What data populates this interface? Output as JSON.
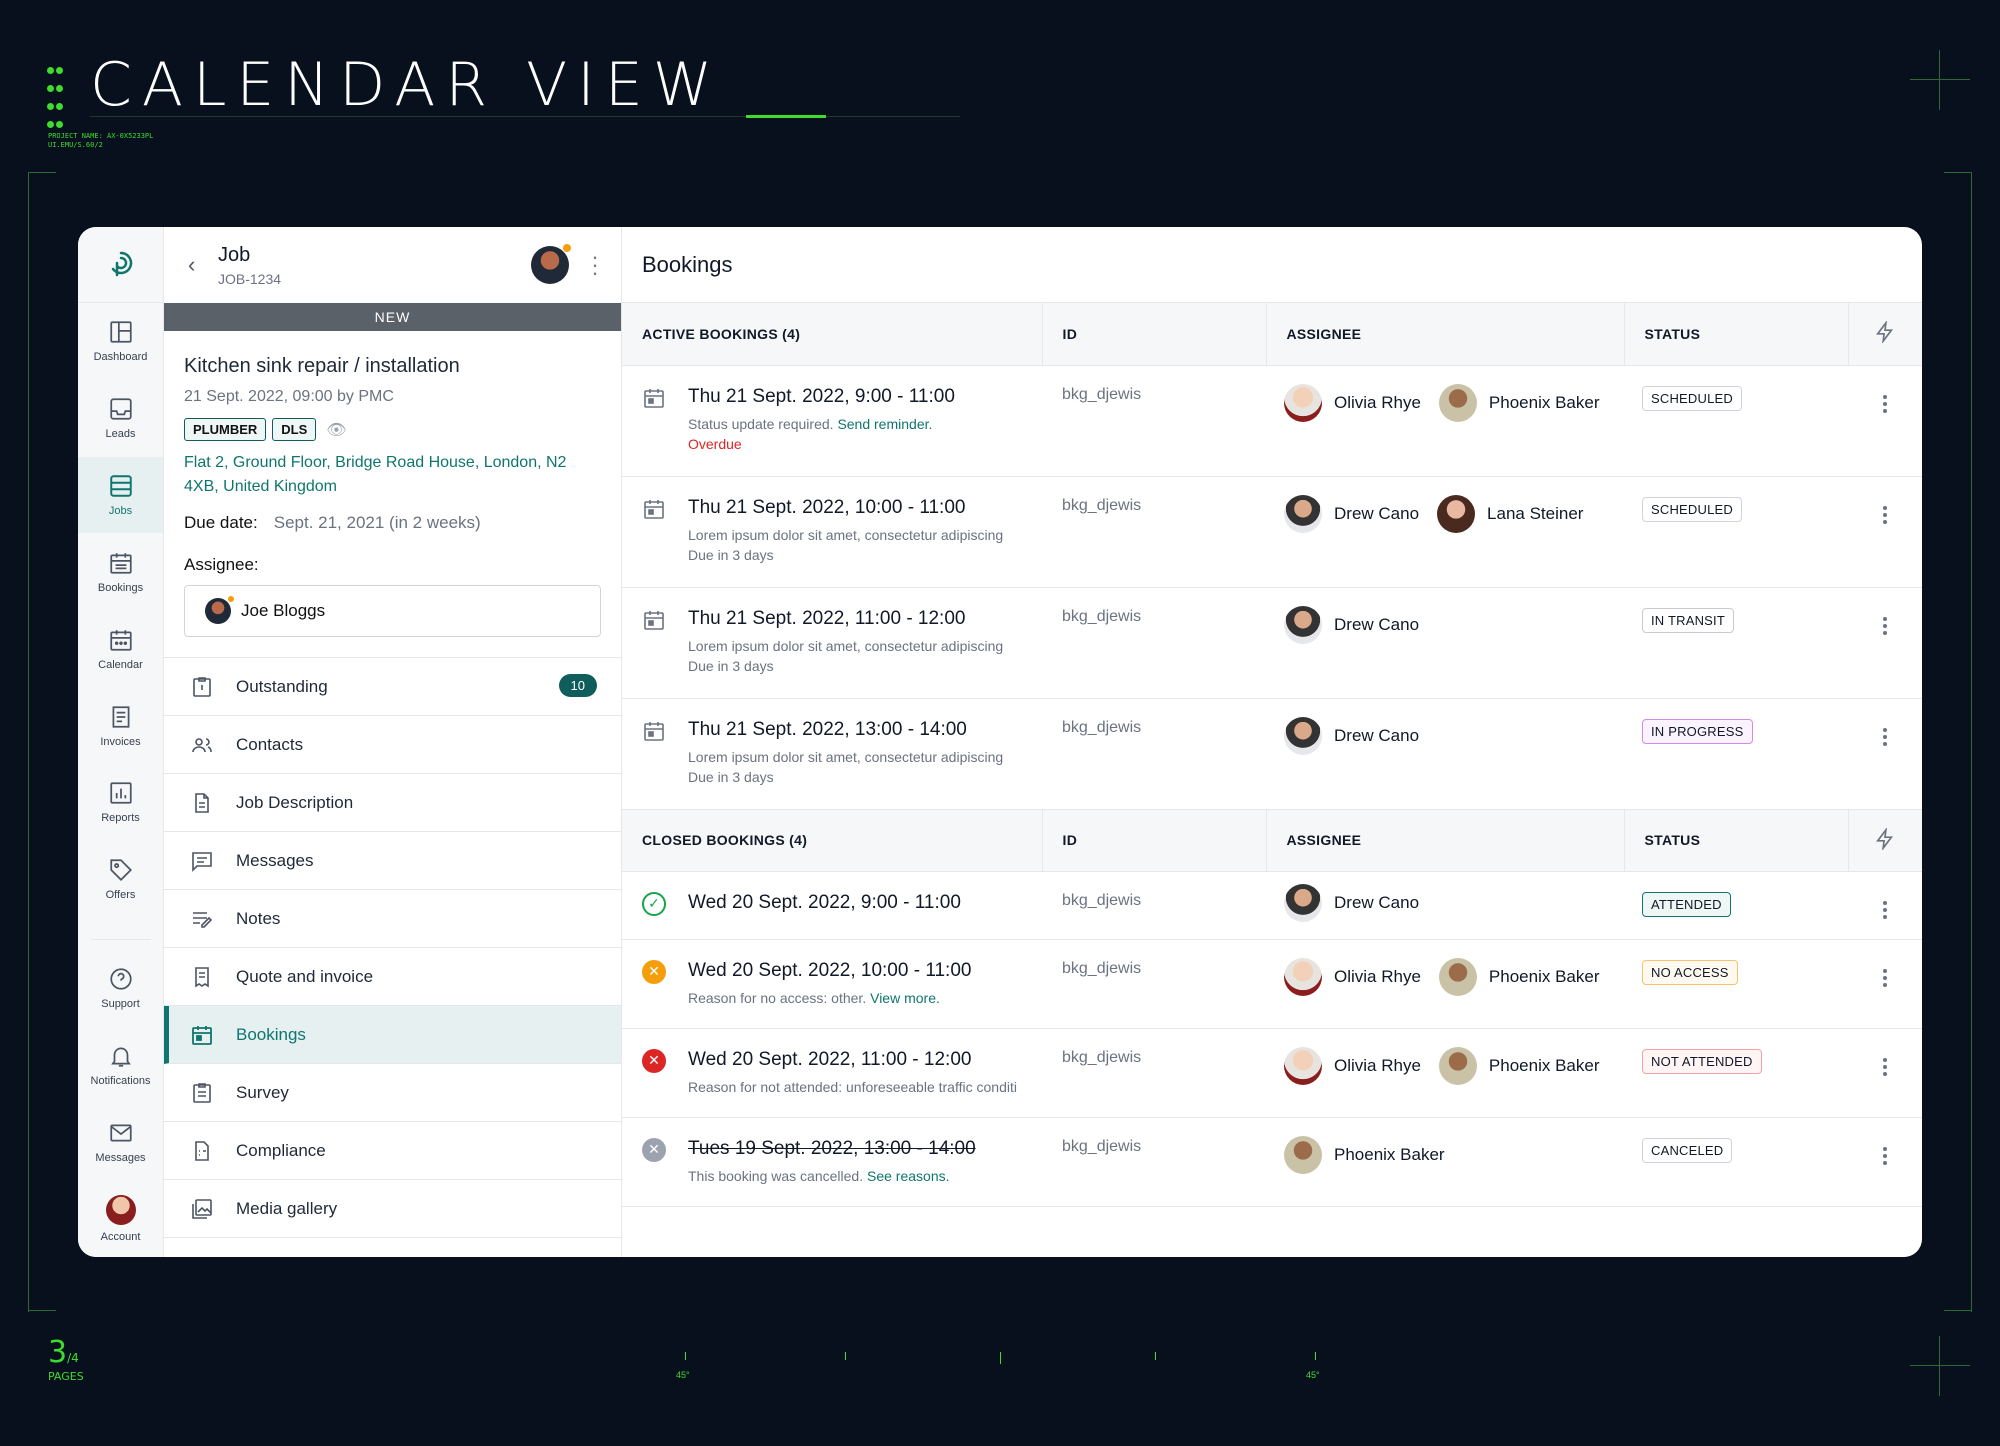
{
  "hero": {
    "title": "CALENDAR VIEW",
    "project_line1": "PROJECT NAME: AX-0X5233PL",
    "project_line2": "UI.EMU/S.60/2",
    "pages_num": "3",
    "pages_total": "/4",
    "pages_label": "PAGES",
    "deg_label": "45°"
  },
  "sidebar": {
    "items": [
      {
        "label": "Dashboard",
        "icon": "dashboard-icon"
      },
      {
        "label": "Leads",
        "icon": "inbox-icon"
      },
      {
        "label": "Jobs",
        "icon": "jobs-icon",
        "active": true
      },
      {
        "label": "Bookings",
        "icon": "bookings-icon"
      },
      {
        "label": "Calendar",
        "icon": "calendar-icon"
      },
      {
        "label": "Invoices",
        "icon": "invoice-icon"
      },
      {
        "label": "Reports",
        "icon": "reports-icon"
      },
      {
        "label": "Offers",
        "icon": "tag-icon"
      }
    ],
    "bottom": [
      {
        "label": "Support",
        "icon": "help-icon"
      },
      {
        "label": "Notifications",
        "icon": "bell-icon"
      },
      {
        "label": "Messages",
        "icon": "mail-icon"
      },
      {
        "label": "Account",
        "icon": "account-avatar"
      }
    ]
  },
  "job": {
    "title": "Job",
    "id": "JOB-1234",
    "status_bar": "NEW",
    "name": "Kitchen sink repair / installation",
    "created": "21 Sept. 2022, 09:00 by PMC",
    "tags": [
      "PLUMBER",
      "DLS"
    ],
    "address": "Flat 2, Ground Floor, Bridge Road House, London, N2 4XB, United Kingdom",
    "due_label": "Due date:",
    "due_value": "Sept. 21, 2021 (in 2 weeks)",
    "assignee_label": "Assignee:",
    "assignee_name": "Joe Bloggs",
    "menu": [
      {
        "label": "Outstanding",
        "icon": "outstanding-icon",
        "badge": "10"
      },
      {
        "label": "Contacts",
        "icon": "contacts-icon"
      },
      {
        "label": "Job Description",
        "icon": "document-icon"
      },
      {
        "label": "Messages",
        "icon": "messages-icon"
      },
      {
        "label": "Notes",
        "icon": "notes-icon"
      },
      {
        "label": "Quote and invoice",
        "icon": "receipt-icon"
      },
      {
        "label": "Bookings",
        "icon": "bookings-icon",
        "active": true
      },
      {
        "label": "Survey",
        "icon": "clipboard-icon"
      },
      {
        "label": "Compliance",
        "icon": "compliance-icon"
      },
      {
        "label": "Media gallery",
        "icon": "gallery-icon"
      }
    ]
  },
  "bookings": {
    "title": "Bookings",
    "active_header": {
      "section": "ACTIVE BOOKINGS (4)",
      "id": "ID",
      "assignee": "ASSIGNEE",
      "status": "STATUS"
    },
    "closed_header": {
      "section": "CLOSED BOOKINGS (4)",
      "id": "ID",
      "assignee": "ASSIGNEE",
      "status": "STATUS"
    },
    "active": [
      {
        "when": "Thu 21 Sept. 2022, 9:00 - 11:00",
        "sub": "Status update required.",
        "sub_link": "Send reminder.",
        "extra": "Overdue",
        "id": "bkg_djewis",
        "people": [
          "Olivia Rhye",
          "Phoenix Baker"
        ],
        "status": "SCHEDULED"
      },
      {
        "when": "Thu 21 Sept. 2022, 10:00 - 11:00",
        "sub": "Lorem ipsum dolor sit amet, consectetur adipiscing",
        "extra": "Due in 3 days",
        "id": "bkg_djewis",
        "people": [
          "Drew Cano",
          "Lana Steiner"
        ],
        "status": "SCHEDULED"
      },
      {
        "when": "Thu 21 Sept. 2022, 11:00 - 12:00",
        "sub": "Lorem ipsum dolor sit amet, consectetur adipiscing",
        "extra": "Due in 3 days",
        "id": "bkg_djewis",
        "people": [
          "Drew Cano"
        ],
        "status": "IN TRANSIT"
      },
      {
        "when": "Thu 21 Sept. 2022, 13:00 - 14:00",
        "sub": "Lorem ipsum dolor sit amet, consectetur adipiscing",
        "extra": "Due in 3 days",
        "id": "bkg_djewis",
        "people": [
          "Drew Cano"
        ],
        "status": "IN PROGRESS"
      }
    ],
    "closed": [
      {
        "when": "Wed 20 Sept. 2022, 9:00 - 11:00",
        "id": "bkg_djewis",
        "people": [
          "Drew Cano"
        ],
        "status": "ATTENDED"
      },
      {
        "when": "Wed 20 Sept. 2022, 10:00 - 11:00",
        "sub": "Reason for no access: other.",
        "sub_link": "View more.",
        "id": "bkg_djewis",
        "people": [
          "Olivia Rhye",
          "Phoenix Baker"
        ],
        "status": "NO ACCESS"
      },
      {
        "when": "Wed 20 Sept. 2022, 11:00 - 12:00",
        "sub": "Reason for not attended: unforeseeable traffic conditi",
        "id": "bkg_djewis",
        "people": [
          "Olivia Rhye",
          "Phoenix Baker"
        ],
        "status": "NOT ATTENDED"
      },
      {
        "when": "Tues 19 Sept. 2022, 13:00 - 14:00",
        "sub": "This booking was cancelled.",
        "sub_link": "See reasons.",
        "id": "bkg_djewis",
        "people": [
          "Phoenix Baker"
        ],
        "status": "CANCELED"
      }
    ]
  },
  "colors": {
    "background": "#07101c",
    "accent_green": "#3ddc2f",
    "brand_teal": "#0f766e",
    "overdue": "#dc2626"
  }
}
